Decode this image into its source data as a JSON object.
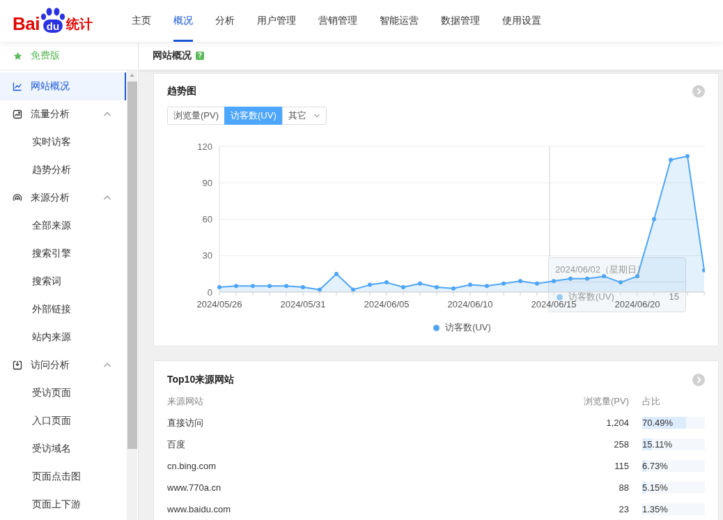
{
  "header": {
    "logo": {
      "text": "Bai",
      "badge": "du",
      "suffix": "统计"
    },
    "nav": [
      {
        "label": "主页",
        "selected": false
      },
      {
        "label": "概况",
        "selected": true
      },
      {
        "label": "分析",
        "selected": false
      },
      {
        "label": "用户管理",
        "selected": false
      },
      {
        "label": "营销管理",
        "selected": false
      },
      {
        "label": "智能运营",
        "selected": false
      },
      {
        "label": "数据管理",
        "selected": false
      },
      {
        "label": "使用设置",
        "selected": false
      }
    ]
  },
  "sidebar": {
    "edition": "免费版",
    "items": [
      {
        "label": "网站概况",
        "kind": "page",
        "selected": true
      },
      {
        "label": "流量分析",
        "kind": "group",
        "selected": false,
        "expanded": true,
        "children": [
          {
            "label": "实时访客",
            "selected": false
          },
          {
            "label": "趋势分析",
            "selected": false
          }
        ]
      },
      {
        "label": "来源分析",
        "kind": "group",
        "selected": false,
        "expanded": true,
        "children": [
          {
            "label": "全部来源",
            "selected": false
          },
          {
            "label": "搜索引擎",
            "selected": false
          },
          {
            "label": "搜索词",
            "selected": false
          },
          {
            "label": "外部链接",
            "selected": false
          },
          {
            "label": "站内来源",
            "selected": false
          }
        ]
      },
      {
        "label": "访问分析",
        "kind": "group",
        "selected": false,
        "expanded": true,
        "children": [
          {
            "label": "受访页面",
            "selected": false
          },
          {
            "label": "入口页面",
            "selected": false
          },
          {
            "label": "受访域名",
            "selected": false
          },
          {
            "label": "页面点击图",
            "selected": false
          },
          {
            "label": "页面上下游",
            "selected": false
          }
        ]
      }
    ]
  },
  "page": {
    "title": "网站概况",
    "help": "?"
  },
  "trend_card": {
    "title": "趋势图",
    "metrics": [
      {
        "label": "浏览量(PV)",
        "kind": "tab",
        "selected": false
      },
      {
        "label": "访客数(UV)",
        "kind": "tab",
        "selected": true
      },
      {
        "label": "其它",
        "kind": "dropdown",
        "selected": false
      }
    ],
    "chart_data": {
      "type": "area",
      "categories": [
        "2024/05/26",
        null,
        null,
        null,
        null,
        "2024/05/31",
        null,
        null,
        null,
        null,
        "2024/06/05",
        null,
        null,
        null,
        null,
        "2024/06/10",
        null,
        null,
        null,
        null,
        "2024/06/15",
        null,
        null,
        null,
        null,
        "2024/06/20",
        null,
        null,
        null,
        null
      ],
      "series": [
        {
          "name": "访客数(UV)",
          "color": "#4ea5f5",
          "values": [
            4,
            5,
            5,
            5,
            5,
            4,
            2,
            15,
            2,
            6,
            8,
            4,
            7,
            4,
            3,
            6,
            5,
            7,
            9,
            7,
            9,
            11,
            11,
            13,
            8,
            13,
            60,
            109,
            112,
            18
          ]
        }
      ],
      "ylim": [
        0,
        120
      ],
      "yticks": [
        0,
        30,
        60,
        90,
        120
      ],
      "grid": true
    },
    "tooltip": {
      "date": "2024/06/02（星期日）",
      "label": "访客数(UV)",
      "value": "15"
    }
  },
  "sources_card": {
    "title": "Top10来源网站",
    "columns": [
      "来源网站",
      "浏览量(PV)",
      "占比"
    ],
    "rows": [
      {
        "site": "直接访问",
        "pv": "1,204",
        "share": "70.49%",
        "level": 0.7049
      },
      {
        "site": "百度",
        "pv": "258",
        "share": "15.11%",
        "level": 0.1511
      },
      {
        "site": "cn.bing.com",
        "pv": "115",
        "share": "6.73%",
        "level": 0.0673
      },
      {
        "site": "www.770a.cn",
        "pv": "88",
        "share": "5.15%",
        "level": 0.0515
      },
      {
        "site": "www.baidu.com",
        "pv": "23",
        "share": "1.35%",
        "level": 0.0135
      }
    ]
  }
}
